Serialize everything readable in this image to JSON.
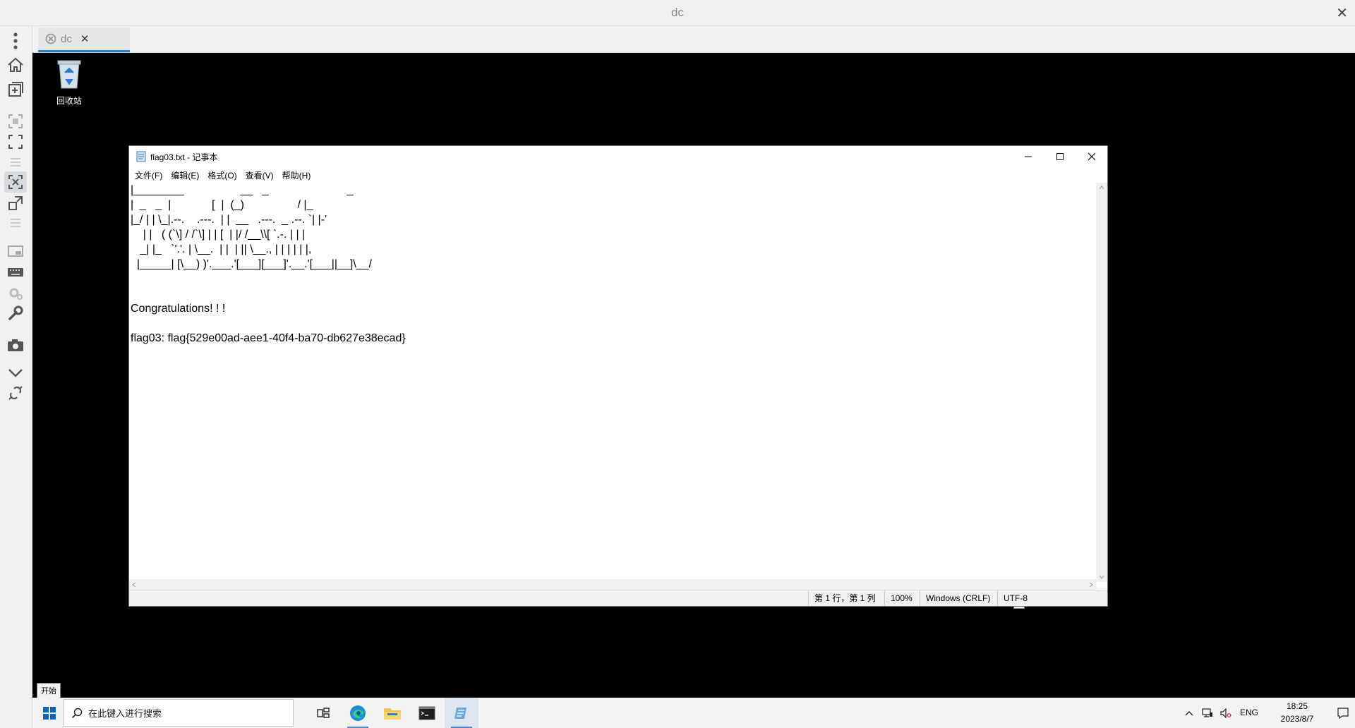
{
  "app": {
    "title": "dc",
    "close_glyph": "✕"
  },
  "tab": {
    "label": "dc",
    "close_glyph": "✕"
  },
  "desktop": {
    "recycle_bin_label": "回收站"
  },
  "notepad": {
    "title": "flag03.txt - 记事本",
    "menus": [
      "文件(F)",
      "编辑(E)",
      "格式(O)",
      "查看(V)",
      "帮助(H)"
    ],
    "content": "|________                  __   _                         _\n|  _   _  |             [  |  (_)                 / |_\n|_/ | | \\_|.--.    .---.  | |  __   .---.  _ .--. `| |-'\n    | |   ( (`\\] / /`\\] | | [  | |/ /__\\\\[ `.-. | | |\n   _| |_   `'.'. | \\__.  | |  | || \\__., | | | | | |,\n  |_____| [\\__) )'.___.'[___][___]'.__.'[___||__]\\__/\n\n\nCongratulations! ! !\n\nflag03: flag{529e00ad-aee1-40f4-ba70-db627e38ecad}",
    "status": {
      "position": "第 1 行，第 1 列",
      "zoom": "100%",
      "line_ending": "Windows (CRLF)",
      "encoding": "UTF-8"
    }
  },
  "taskbar": {
    "start_tooltip": "开始",
    "search_placeholder": "在此键入进行搜索",
    "language": "ENG",
    "time": "18:25",
    "date": "2023/8/7"
  },
  "colors": {
    "accent": "#2d7fd6",
    "remote_bg": "#000000",
    "toolbar_bg": "#f0f0f0",
    "taskbar_bg": "#f3f3f3"
  }
}
